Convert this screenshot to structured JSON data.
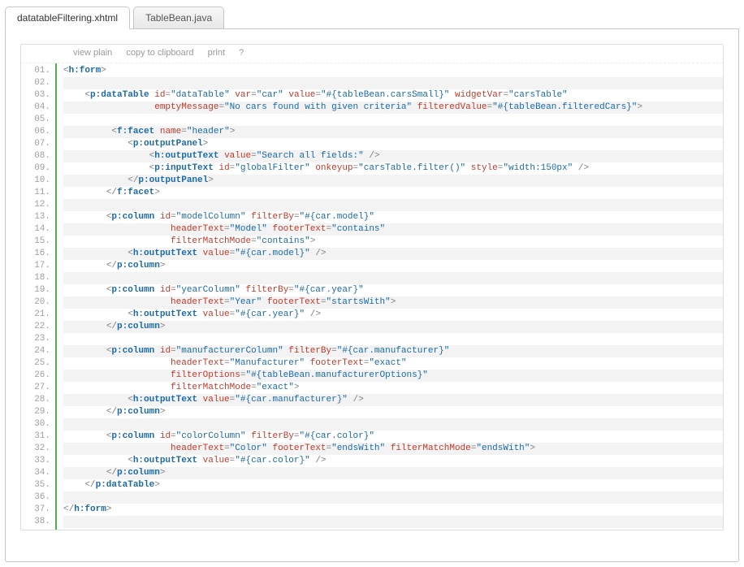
{
  "tabs": [
    {
      "label": "datatableFiltering.xhtml",
      "active": true
    },
    {
      "label": "TableBean.java",
      "active": false
    }
  ],
  "toolbar": {
    "view": "view plain",
    "copy": "copy to clipboard",
    "print": "print",
    "help": "?"
  },
  "lines": [
    {
      "n": "01.",
      "tokens": [
        {
          "t": "punct",
          "v": "<"
        },
        {
          "t": "tagname",
          "v": "h:form"
        },
        {
          "t": "punct",
          "v": ">"
        }
      ]
    },
    {
      "n": "02.",
      "tokens": [
        {
          "t": "plain",
          "v": "  "
        }
      ]
    },
    {
      "n": "03.",
      "tokens": [
        {
          "t": "plain",
          "v": "    "
        },
        {
          "t": "punct",
          "v": "<"
        },
        {
          "t": "tagname",
          "v": "p:dataTable"
        },
        {
          "t": "plain",
          "v": " "
        },
        {
          "t": "attr",
          "v": "id"
        },
        {
          "t": "punct",
          "v": "="
        },
        {
          "t": "val",
          "v": "\"dataTable\""
        },
        {
          "t": "plain",
          "v": " "
        },
        {
          "t": "attr",
          "v": "var"
        },
        {
          "t": "punct",
          "v": "="
        },
        {
          "t": "val",
          "v": "\"car\""
        },
        {
          "t": "plain",
          "v": " "
        },
        {
          "t": "attr",
          "v": "value"
        },
        {
          "t": "punct",
          "v": "="
        },
        {
          "t": "val",
          "v": "\"#{tableBean.carsSmall}\""
        },
        {
          "t": "plain",
          "v": " "
        },
        {
          "t": "attr",
          "v": "widgetVar"
        },
        {
          "t": "punct",
          "v": "="
        },
        {
          "t": "val",
          "v": "\"carsTable\""
        }
      ]
    },
    {
      "n": "04.",
      "tokens": [
        {
          "t": "plain",
          "v": "                 "
        },
        {
          "t": "attr",
          "v": "emptyMessage"
        },
        {
          "t": "punct",
          "v": "="
        },
        {
          "t": "val",
          "v": "\"No cars found with given criteria\""
        },
        {
          "t": "plain",
          "v": " "
        },
        {
          "t": "attr",
          "v": "filteredValue"
        },
        {
          "t": "punct",
          "v": "="
        },
        {
          "t": "val",
          "v": "\"#{tableBean.filteredCars}\""
        },
        {
          "t": "punct",
          "v": ">"
        }
      ]
    },
    {
      "n": "05.",
      "tokens": [
        {
          "t": "plain",
          "v": "  "
        }
      ]
    },
    {
      "n": "06.",
      "tokens": [
        {
          "t": "plain",
          "v": "         "
        },
        {
          "t": "punct",
          "v": "<"
        },
        {
          "t": "tagname",
          "v": "f:facet"
        },
        {
          "t": "plain",
          "v": " "
        },
        {
          "t": "attr",
          "v": "name"
        },
        {
          "t": "punct",
          "v": "="
        },
        {
          "t": "val",
          "v": "\"header\""
        },
        {
          "t": "punct",
          "v": ">"
        }
      ]
    },
    {
      "n": "07.",
      "tokens": [
        {
          "t": "plain",
          "v": "            "
        },
        {
          "t": "punct",
          "v": "<"
        },
        {
          "t": "tagname",
          "v": "p:outputPanel"
        },
        {
          "t": "punct",
          "v": ">"
        }
      ]
    },
    {
      "n": "08.",
      "tokens": [
        {
          "t": "plain",
          "v": "                "
        },
        {
          "t": "punct",
          "v": "<"
        },
        {
          "t": "tagname",
          "v": "h:outputText"
        },
        {
          "t": "plain",
          "v": " "
        },
        {
          "t": "attr",
          "v": "value"
        },
        {
          "t": "punct",
          "v": "="
        },
        {
          "t": "val",
          "v": "\"Search all fields:\""
        },
        {
          "t": "plain",
          "v": " "
        },
        {
          "t": "punct",
          "v": "/>"
        }
      ]
    },
    {
      "n": "09.",
      "tokens": [
        {
          "t": "plain",
          "v": "                "
        },
        {
          "t": "punct",
          "v": "<"
        },
        {
          "t": "tagname",
          "v": "p:inputText"
        },
        {
          "t": "plain",
          "v": " "
        },
        {
          "t": "attr",
          "v": "id"
        },
        {
          "t": "punct",
          "v": "="
        },
        {
          "t": "val",
          "v": "\"globalFilter\""
        },
        {
          "t": "plain",
          "v": " "
        },
        {
          "t": "attr",
          "v": "onkeyup"
        },
        {
          "t": "punct",
          "v": "="
        },
        {
          "t": "val",
          "v": "\"carsTable.filter()\""
        },
        {
          "t": "plain",
          "v": " "
        },
        {
          "t": "attr",
          "v": "style"
        },
        {
          "t": "punct",
          "v": "="
        },
        {
          "t": "val",
          "v": "\"width:150px\""
        },
        {
          "t": "plain",
          "v": " "
        },
        {
          "t": "punct",
          "v": "/>"
        }
      ]
    },
    {
      "n": "10.",
      "tokens": [
        {
          "t": "plain",
          "v": "            "
        },
        {
          "t": "punct",
          "v": "</"
        },
        {
          "t": "tagname",
          "v": "p:outputPanel"
        },
        {
          "t": "punct",
          "v": ">"
        }
      ]
    },
    {
      "n": "11.",
      "tokens": [
        {
          "t": "plain",
          "v": "        "
        },
        {
          "t": "punct",
          "v": "</"
        },
        {
          "t": "tagname",
          "v": "f:facet"
        },
        {
          "t": "punct",
          "v": ">"
        }
      ]
    },
    {
      "n": "12.",
      "tokens": [
        {
          "t": "plain",
          "v": "  "
        }
      ]
    },
    {
      "n": "13.",
      "tokens": [
        {
          "t": "plain",
          "v": "        "
        },
        {
          "t": "punct",
          "v": "<"
        },
        {
          "t": "tagname",
          "v": "p:column"
        },
        {
          "t": "plain",
          "v": " "
        },
        {
          "t": "attr",
          "v": "id"
        },
        {
          "t": "punct",
          "v": "="
        },
        {
          "t": "val",
          "v": "\"modelColumn\""
        },
        {
          "t": "plain",
          "v": " "
        },
        {
          "t": "attr",
          "v": "filterBy"
        },
        {
          "t": "punct",
          "v": "="
        },
        {
          "t": "val",
          "v": "\"#{car.model}\""
        },
        {
          "t": "plain",
          "v": "   "
        }
      ]
    },
    {
      "n": "14.",
      "tokens": [
        {
          "t": "plain",
          "v": "                    "
        },
        {
          "t": "attr",
          "v": "headerText"
        },
        {
          "t": "punct",
          "v": "="
        },
        {
          "t": "val",
          "v": "\"Model\""
        },
        {
          "t": "plain",
          "v": " "
        },
        {
          "t": "attr",
          "v": "footerText"
        },
        {
          "t": "punct",
          "v": "="
        },
        {
          "t": "val",
          "v": "\"contains\""
        }
      ]
    },
    {
      "n": "15.",
      "tokens": [
        {
          "t": "plain",
          "v": "                    "
        },
        {
          "t": "attr",
          "v": "filterMatchMode"
        },
        {
          "t": "punct",
          "v": "="
        },
        {
          "t": "val",
          "v": "\"contains\""
        },
        {
          "t": "punct",
          "v": ">"
        }
      ]
    },
    {
      "n": "16.",
      "tokens": [
        {
          "t": "plain",
          "v": "            "
        },
        {
          "t": "punct",
          "v": "<"
        },
        {
          "t": "tagname",
          "v": "h:outputText"
        },
        {
          "t": "plain",
          "v": " "
        },
        {
          "t": "attr",
          "v": "value"
        },
        {
          "t": "punct",
          "v": "="
        },
        {
          "t": "val",
          "v": "\"#{car.model}\""
        },
        {
          "t": "plain",
          "v": " "
        },
        {
          "t": "punct",
          "v": "/>"
        }
      ]
    },
    {
      "n": "17.",
      "tokens": [
        {
          "t": "plain",
          "v": "        "
        },
        {
          "t": "punct",
          "v": "</"
        },
        {
          "t": "tagname",
          "v": "p:column"
        },
        {
          "t": "punct",
          "v": ">"
        }
      ]
    },
    {
      "n": "18.",
      "tokens": [
        {
          "t": "plain",
          "v": "  "
        }
      ]
    },
    {
      "n": "19.",
      "tokens": [
        {
          "t": "plain",
          "v": "        "
        },
        {
          "t": "punct",
          "v": "<"
        },
        {
          "t": "tagname",
          "v": "p:column"
        },
        {
          "t": "plain",
          "v": " "
        },
        {
          "t": "attr",
          "v": "id"
        },
        {
          "t": "punct",
          "v": "="
        },
        {
          "t": "val",
          "v": "\"yearColumn\""
        },
        {
          "t": "plain",
          "v": " "
        },
        {
          "t": "attr",
          "v": "filterBy"
        },
        {
          "t": "punct",
          "v": "="
        },
        {
          "t": "val",
          "v": "\"#{car.year}\""
        }
      ]
    },
    {
      "n": "20.",
      "tokens": [
        {
          "t": "plain",
          "v": "                    "
        },
        {
          "t": "attr",
          "v": "headerText"
        },
        {
          "t": "punct",
          "v": "="
        },
        {
          "t": "val",
          "v": "\"Year\""
        },
        {
          "t": "plain",
          "v": " "
        },
        {
          "t": "attr",
          "v": "footerText"
        },
        {
          "t": "punct",
          "v": "="
        },
        {
          "t": "val",
          "v": "\"startsWith\""
        },
        {
          "t": "punct",
          "v": ">"
        }
      ]
    },
    {
      "n": "21.",
      "tokens": [
        {
          "t": "plain",
          "v": "            "
        },
        {
          "t": "punct",
          "v": "<"
        },
        {
          "t": "tagname",
          "v": "h:outputText"
        },
        {
          "t": "plain",
          "v": " "
        },
        {
          "t": "attr",
          "v": "value"
        },
        {
          "t": "punct",
          "v": "="
        },
        {
          "t": "val",
          "v": "\"#{car.year}\""
        },
        {
          "t": "plain",
          "v": " "
        },
        {
          "t": "punct",
          "v": "/>"
        }
      ]
    },
    {
      "n": "22.",
      "tokens": [
        {
          "t": "plain",
          "v": "        "
        },
        {
          "t": "punct",
          "v": "</"
        },
        {
          "t": "tagname",
          "v": "p:column"
        },
        {
          "t": "punct",
          "v": ">"
        }
      ]
    },
    {
      "n": "23.",
      "tokens": [
        {
          "t": "plain",
          "v": "  "
        }
      ]
    },
    {
      "n": "24.",
      "tokens": [
        {
          "t": "plain",
          "v": "        "
        },
        {
          "t": "punct",
          "v": "<"
        },
        {
          "t": "tagname",
          "v": "p:column"
        },
        {
          "t": "plain",
          "v": " "
        },
        {
          "t": "attr",
          "v": "id"
        },
        {
          "t": "punct",
          "v": "="
        },
        {
          "t": "val",
          "v": "\"manufacturerColumn\""
        },
        {
          "t": "plain",
          "v": " "
        },
        {
          "t": "attr",
          "v": "filterBy"
        },
        {
          "t": "punct",
          "v": "="
        },
        {
          "t": "val",
          "v": "\"#{car.manufacturer}\""
        },
        {
          "t": "plain",
          "v": "   "
        }
      ]
    },
    {
      "n": "25.",
      "tokens": [
        {
          "t": "plain",
          "v": "                    "
        },
        {
          "t": "attr",
          "v": "headerText"
        },
        {
          "t": "punct",
          "v": "="
        },
        {
          "t": "val",
          "v": "\"Manufacturer\""
        },
        {
          "t": "plain",
          "v": " "
        },
        {
          "t": "attr",
          "v": "footerText"
        },
        {
          "t": "punct",
          "v": "="
        },
        {
          "t": "val",
          "v": "\"exact\""
        }
      ]
    },
    {
      "n": "26.",
      "tokens": [
        {
          "t": "plain",
          "v": "                    "
        },
        {
          "t": "attr",
          "v": "filterOptions"
        },
        {
          "t": "punct",
          "v": "="
        },
        {
          "t": "val",
          "v": "\"#{tableBean.manufacturerOptions}\""
        }
      ]
    },
    {
      "n": "27.",
      "tokens": [
        {
          "t": "plain",
          "v": "                    "
        },
        {
          "t": "attr",
          "v": "filterMatchMode"
        },
        {
          "t": "punct",
          "v": "="
        },
        {
          "t": "val",
          "v": "\"exact\""
        },
        {
          "t": "punct",
          "v": ">"
        }
      ]
    },
    {
      "n": "28.",
      "tokens": [
        {
          "t": "plain",
          "v": "            "
        },
        {
          "t": "punct",
          "v": "<"
        },
        {
          "t": "tagname",
          "v": "h:outputText"
        },
        {
          "t": "plain",
          "v": " "
        },
        {
          "t": "attr",
          "v": "value"
        },
        {
          "t": "punct",
          "v": "="
        },
        {
          "t": "val",
          "v": "\"#{car.manufacturer}\""
        },
        {
          "t": "plain",
          "v": " "
        },
        {
          "t": "punct",
          "v": "/>"
        }
      ]
    },
    {
      "n": "29.",
      "tokens": [
        {
          "t": "plain",
          "v": "        "
        },
        {
          "t": "punct",
          "v": "</"
        },
        {
          "t": "tagname",
          "v": "p:column"
        },
        {
          "t": "punct",
          "v": ">"
        }
      ]
    },
    {
      "n": "30.",
      "tokens": [
        {
          "t": "plain",
          "v": "  "
        }
      ]
    },
    {
      "n": "31.",
      "tokens": [
        {
          "t": "plain",
          "v": "        "
        },
        {
          "t": "punct",
          "v": "<"
        },
        {
          "t": "tagname",
          "v": "p:column"
        },
        {
          "t": "plain",
          "v": " "
        },
        {
          "t": "attr",
          "v": "id"
        },
        {
          "t": "punct",
          "v": "="
        },
        {
          "t": "val",
          "v": "\"colorColumn\""
        },
        {
          "t": "plain",
          "v": " "
        },
        {
          "t": "attr",
          "v": "filterBy"
        },
        {
          "t": "punct",
          "v": "="
        },
        {
          "t": "val",
          "v": "\"#{car.color}\""
        }
      ]
    },
    {
      "n": "32.",
      "tokens": [
        {
          "t": "plain",
          "v": "                    "
        },
        {
          "t": "attr",
          "v": "headerText"
        },
        {
          "t": "punct",
          "v": "="
        },
        {
          "t": "val",
          "v": "\"Color\""
        },
        {
          "t": "plain",
          "v": " "
        },
        {
          "t": "attr",
          "v": "footerText"
        },
        {
          "t": "punct",
          "v": "="
        },
        {
          "t": "val",
          "v": "\"endsWith\""
        },
        {
          "t": "plain",
          "v": " "
        },
        {
          "t": "attr",
          "v": "filterMatchMode"
        },
        {
          "t": "punct",
          "v": "="
        },
        {
          "t": "val",
          "v": "\"endsWith\""
        },
        {
          "t": "punct",
          "v": ">"
        }
      ]
    },
    {
      "n": "33.",
      "tokens": [
        {
          "t": "plain",
          "v": "            "
        },
        {
          "t": "punct",
          "v": "<"
        },
        {
          "t": "tagname",
          "v": "h:outputText"
        },
        {
          "t": "plain",
          "v": " "
        },
        {
          "t": "attr",
          "v": "value"
        },
        {
          "t": "punct",
          "v": "="
        },
        {
          "t": "val",
          "v": "\"#{car.color}\""
        },
        {
          "t": "plain",
          "v": " "
        },
        {
          "t": "punct",
          "v": "/>"
        }
      ]
    },
    {
      "n": "34.",
      "tokens": [
        {
          "t": "plain",
          "v": "        "
        },
        {
          "t": "punct",
          "v": "</"
        },
        {
          "t": "tagname",
          "v": "p:column"
        },
        {
          "t": "punct",
          "v": ">"
        }
      ]
    },
    {
      "n": "35.",
      "tokens": [
        {
          "t": "plain",
          "v": "    "
        },
        {
          "t": "punct",
          "v": "</"
        },
        {
          "t": "tagname",
          "v": "p:dataTable"
        },
        {
          "t": "punct",
          "v": ">"
        }
      ]
    },
    {
      "n": "36.",
      "tokens": [
        {
          "t": "plain",
          "v": "  "
        }
      ]
    },
    {
      "n": "37.",
      "tokens": [
        {
          "t": "punct",
          "v": "</"
        },
        {
          "t": "tagname",
          "v": "h:form"
        },
        {
          "t": "punct",
          "v": ">"
        }
      ]
    },
    {
      "n": "38.",
      "tokens": [
        {
          "t": "plain",
          "v": "            "
        }
      ]
    }
  ]
}
